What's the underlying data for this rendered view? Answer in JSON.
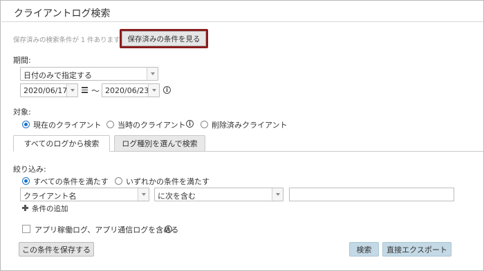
{
  "window": {
    "title": "クライアントログ検索"
  },
  "saved": {
    "message": "保存済みの検索条件が 1 件あります。",
    "button_label": "保存済みの条件を見る"
  },
  "period": {
    "label": "期間:",
    "mode_value": "日付のみで指定する",
    "start_date": "2020/06/17",
    "range_sep": "～",
    "end_date": "2020/06/23"
  },
  "target": {
    "label": "対象:",
    "options": [
      "現在のクライアント",
      "当時のクライアント",
      "削除済みクライアント"
    ],
    "selected": 0
  },
  "tabs": [
    "すべてのログから検索",
    "ログ種別を選んで検索"
  ],
  "filter": {
    "label": "絞り込み:",
    "match_options": [
      "すべての条件を満たす",
      "いずれかの条件を満たす"
    ],
    "match_selected": 0,
    "field_value": "クライアント名",
    "operator_value": "に次を含む",
    "text_value": "",
    "add_condition_label": "条件の追加"
  },
  "include_app_logs_label": "アプリ稼働ログ、アプリ通信ログを含める",
  "buttons": {
    "save_condition": "この条件を保存する",
    "search": "検索",
    "direct_export": "直接エクスポート"
  },
  "colors": {
    "accent_border": "#8b1c1c",
    "radio_blue": "#1a73c9",
    "primary_button": "#c4d9e6"
  }
}
